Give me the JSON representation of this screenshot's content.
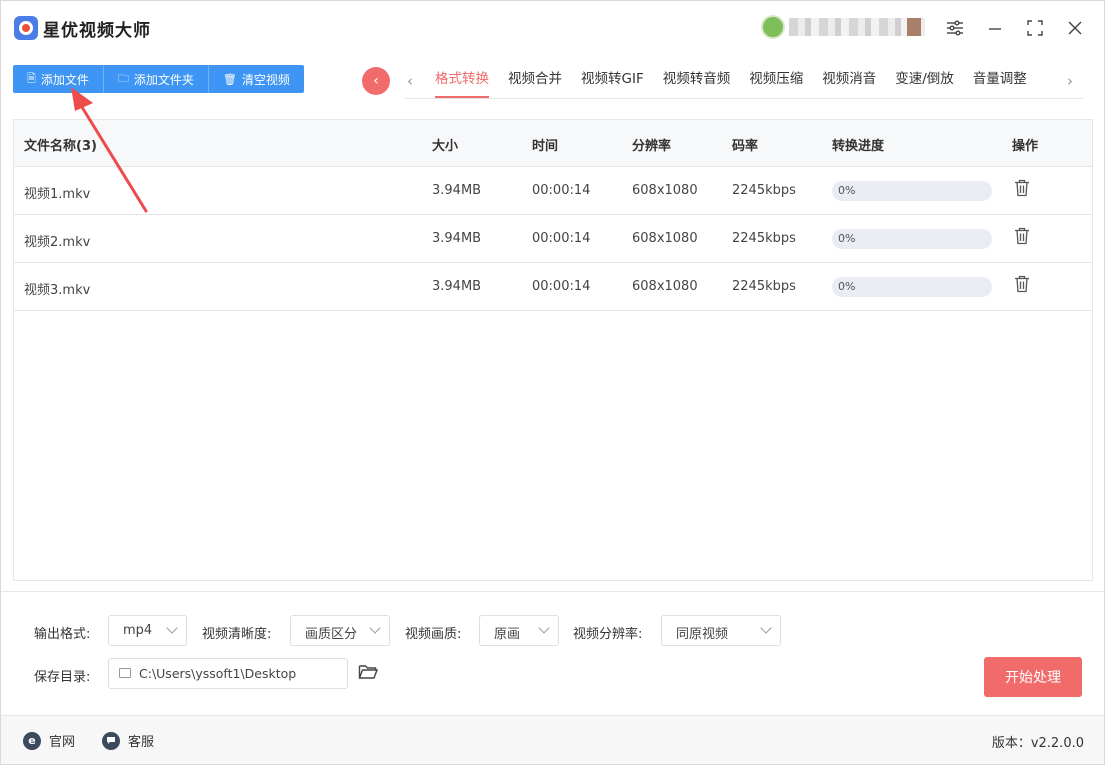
{
  "app": {
    "title": "星优视频大师"
  },
  "titlebar": {
    "icons": [
      "settings-sliders-icon",
      "minimize-icon",
      "maximize-icon",
      "close-icon"
    ]
  },
  "toolbar": {
    "add_file": "添加文件",
    "add_folder": "添加文件夹",
    "clear_videos": "清空视频"
  },
  "tabs": [
    {
      "label": "格式转换",
      "active": true
    },
    {
      "label": "视频合并"
    },
    {
      "label": "视频转GIF"
    },
    {
      "label": "视频转音频"
    },
    {
      "label": "视频压缩"
    },
    {
      "label": "视频消音"
    },
    {
      "label": "变速/倒放"
    },
    {
      "label": "音量调整"
    }
  ],
  "table": {
    "headers": {
      "name": "文件名称(3)",
      "size": "大小",
      "time": "时间",
      "resolution": "分辨率",
      "bitrate": "码率",
      "progress": "转换进度",
      "action": "操作"
    },
    "rows": [
      {
        "name": "视频1.mkv",
        "size": "3.94MB",
        "time": "00:00:14",
        "resolution": "608x1080",
        "bitrate": "2245kbps",
        "progress_label": "0%",
        "progress": 0
      },
      {
        "name": "视频2.mkv",
        "size": "3.94MB",
        "time": "00:00:14",
        "resolution": "608x1080",
        "bitrate": "2245kbps",
        "progress_label": "0%",
        "progress": 0
      },
      {
        "name": "视频3.mkv",
        "size": "3.94MB",
        "time": "00:00:14",
        "resolution": "608x1080",
        "bitrate": "2245kbps",
        "progress_label": "0%",
        "progress": 0
      }
    ]
  },
  "settings": {
    "output_format_label": "输出格式:",
    "output_format_value": "mp4",
    "clarity_label": "视频清晰度:",
    "clarity_value": "画质区分",
    "quality_label": "视频画质:",
    "quality_value": "原画",
    "resolution_label": "视频分辨率:",
    "resolution_value": "同原视频",
    "save_dir_label": "保存目录:",
    "save_dir_value": "C:\\Users\\yssoft1\\Desktop",
    "start_button": "开始处理"
  },
  "footer": {
    "website": "官网",
    "website_icon_glyph": "e",
    "support": "客服",
    "version": "版本：v2.2.0.0"
  },
  "colors": {
    "primary_blue": "#3e95f3",
    "accent_red": "#f26b6b",
    "arrow_red": "#ee4b4b"
  }
}
